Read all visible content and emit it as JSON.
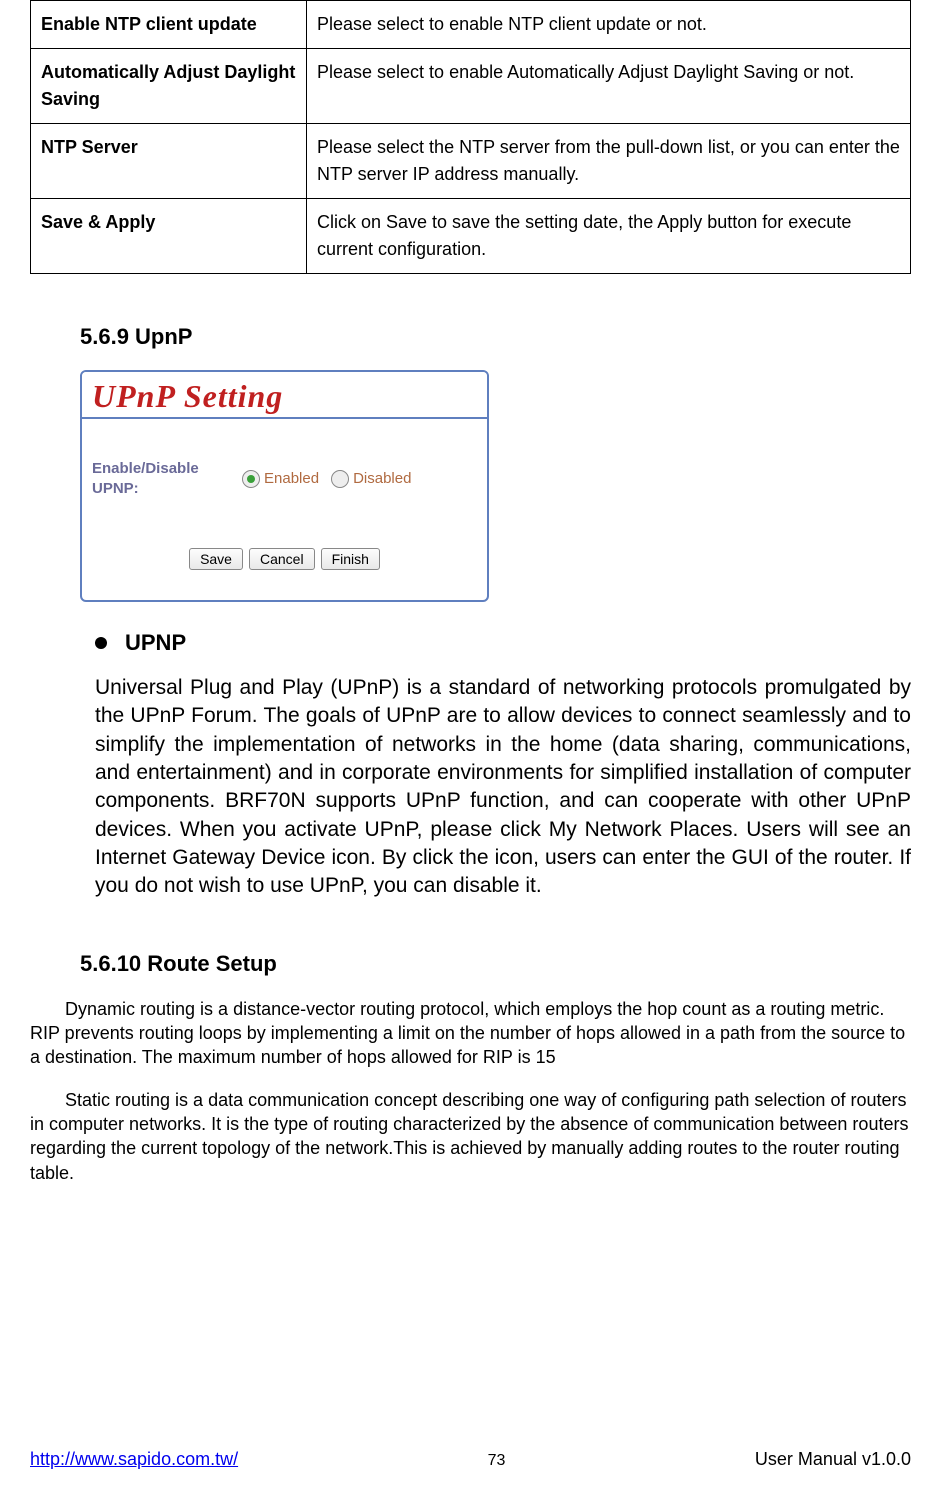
{
  "settings_table": {
    "rows": [
      {
        "label": "Enable NTP client update",
        "desc": "Please select to enable NTP client update or not."
      },
      {
        "label": "Automatically Adjust Daylight Saving",
        "desc": "Please select to enable Automatically Adjust Daylight Saving or not."
      },
      {
        "label": "NTP Server",
        "desc": "Please select the NTP server from the pull-down list, or you can enter the NTP server IP address manually."
      },
      {
        "label": "Save & Apply",
        "desc": "Click on Save to save the setting date, the Apply button for execute current configuration."
      }
    ]
  },
  "upnp_section": {
    "number_heading": "5.6.9   UpnP",
    "panel_title": "UPnP Setting",
    "row_label": "Enable/Disable UPNP:",
    "option_enabled": "Enabled",
    "option_disabled": "Disabled",
    "btn_save": "Save",
    "btn_cancel": "Cancel",
    "btn_finish": "Finish",
    "bullet_heading": "UPNP",
    "paragraph": "Universal Plug and Play (UPnP) is a standard of networking protocols promulgated by the UPnP Forum. The goals of UPnP are to allow devices to connect seamlessly and to simplify the implementation of networks in the home (data sharing, communications, and entertainment) and in corporate environments for simplified installation of computer components. BRF70N supports UPnP function, and can cooperate with other UPnP devices. When you activate UPnP, please click My Network Places. Users will see an Internet Gateway Device icon. By click the icon, users can enter the GUI of the router. If you do not wish to use UPnP, you can disable it."
  },
  "route_section": {
    "number_heading": "5.6.10 Route Setup",
    "p1": "Dynamic routing is a distance-vector routing protocol, which employs the hop count as a routing metric. RIP prevents routing loops by implementing a limit on the number of hops allowed in a path from the source to a destination. The maximum number of hops allowed for RIP is 15",
    "p2": "Static routing is a data communication concept describing one way of configuring path selection of routers in computer networks. It is the type of routing characterized by the absence of communication between routers regarding the current topology of the network.This is achieved by manually adding routes to the router routing table."
  },
  "footer": {
    "url": "http://www.sapido.com.tw/",
    "page": "73",
    "right": "User  Manual  v1.0.0"
  }
}
